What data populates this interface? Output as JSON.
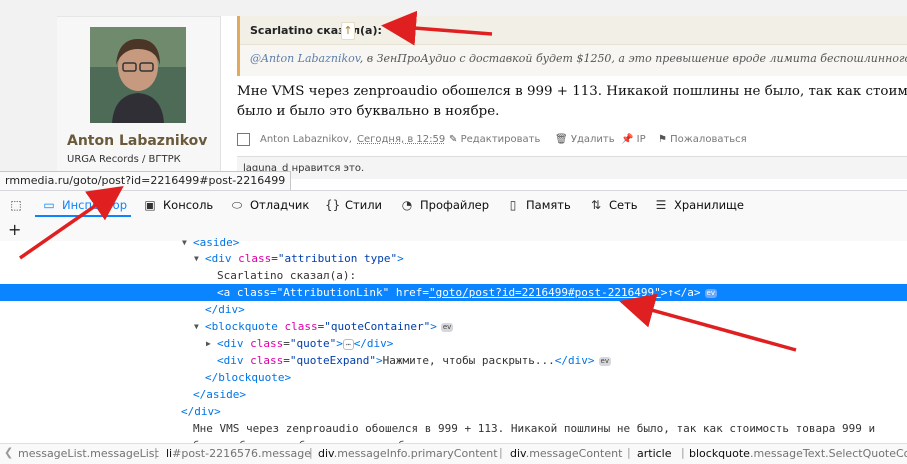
{
  "forum": {
    "username": "Anton Labaznikov",
    "user_title": "URGA Records / ВГТРК",
    "quote_author": "Scarlatino сказал(а):",
    "quote_link_glyph": "↑",
    "quote_mention": "@Anton Labaznikov",
    "quote_text_rest": ", в ЗенПроАудио с доставкой будет $1250, а это превышение вроде лимита беспошлинного ввоз",
    "post_line1": "Мне VMS через zenproaudio обошелся в 999 + 113. Никакой пошлины не было, так как стоимость т",
    "post_line2": "было и было это буквально в ноябре.",
    "meta_author": "Anton Labaznikov",
    "meta_date": "Сегодня, в 12:59",
    "edit_label": "Редактировать",
    "delete_label": "Удалить",
    "ip_label": "IP",
    "report_label": "Пожаловаться",
    "likes_text": "laguna_d нравится это."
  },
  "status_url": "rmmedia.ru/goto/post?id=2216499#post-2216499",
  "devtools": {
    "tabs": [
      {
        "label": "Инспектор",
        "icon": "inspector-icon"
      },
      {
        "label": "Консоль",
        "icon": "console-icon"
      },
      {
        "label": "Отладчик",
        "icon": "debugger-icon"
      },
      {
        "label": "Стили",
        "icon": "styles-icon"
      },
      {
        "label": "Профайлер",
        "icon": "profiler-icon"
      },
      {
        "label": "Память",
        "icon": "memory-icon"
      },
      {
        "label": "Сеть",
        "icon": "network-icon"
      },
      {
        "label": "Хранилище",
        "icon": "storage-icon"
      }
    ],
    "markup": {
      "aside_open": "<aside>",
      "div_attr_open": "<div",
      "class_attr": "class",
      "attribution_class": "\"attribution type\"",
      "gt": ">",
      "attribution_text": "Scarlatino сказал(а):",
      "a_open": "<a",
      "attribution_link_class": "\"AttributionLink\"",
      "href_attr": "href",
      "href_value": "\"goto/post?id=2216499#post-2216499\"",
      "link_text": "↑",
      "a_close": "</a>",
      "div_close": "</div>",
      "blockquote_open": "<blockquote",
      "quote_container_class": "\"quoteContainer\"",
      "quote_class": "\"quote\"",
      "dots": "⋯",
      "quote_expand_class": "\"quoteExpand\"",
      "quote_expand_text": "Нажмите, чтобы раскрыть...",
      "blockquote_close": "</blockquote>",
      "aside_close": "</aside>",
      "text_line1": "Мне VMS через zenproaudio обошелся в 999 + 113. Никакой пошлины не было, так как стоимость товара 999 и",
      "text_line2": "было и было это буквально в ноябре.",
      "ev_badge": "ev"
    },
    "breadcrumbs": [
      {
        "tag": "",
        "cls": "messageList.messageList"
      },
      {
        "tag": "li",
        "cls": "#post-2216576.message"
      },
      {
        "tag": "div",
        "cls": ".messageInfo.primaryContent"
      },
      {
        "tag": "div",
        "cls": ".messageContent"
      },
      {
        "tag": "article",
        "cls": ""
      },
      {
        "tag": "blockquote",
        "cls": ".messageText.SelectQuoteCont"
      }
    ]
  },
  "colors": {
    "arrow": "#e02020",
    "selection": "#0a84ff",
    "tag": "#0074e8",
    "attr": "#dd00a9"
  }
}
